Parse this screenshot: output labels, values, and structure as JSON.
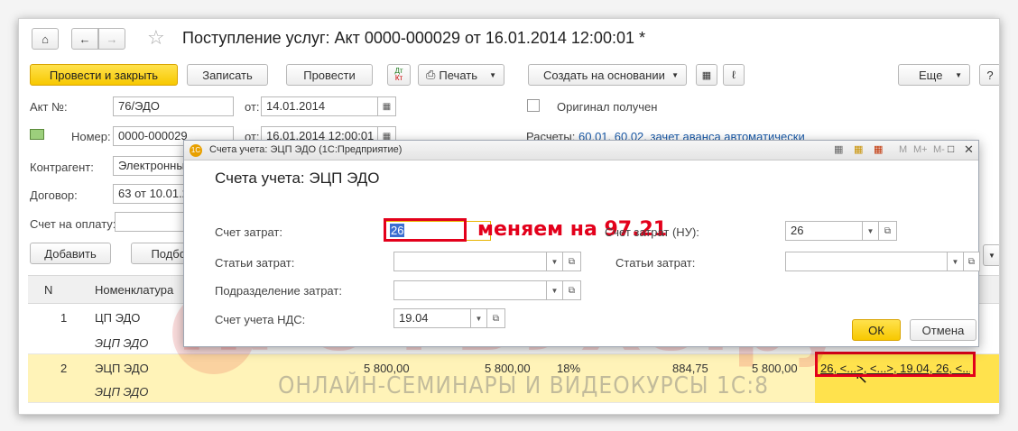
{
  "header": {
    "title": "Поступление услуг: Акт 0000-000029 от 16.01.2014 12:00:01 *"
  },
  "toolbar": {
    "post_close": "Провести и закрыть",
    "save": "Записать",
    "post": "Провести",
    "print": "Печать",
    "create_based": "Создать на основании",
    "more": "Еще",
    "help": "?"
  },
  "form": {
    "act_label": "Акт №:",
    "act_value": "76/ЭДО",
    "from_label": "от:",
    "act_date": "14.01.2014",
    "original_label": "Оригинал получен",
    "number_label": "Номер:",
    "number_value": "0000-000029",
    "number_date": "16.01.2014 12:00:01",
    "settlements_label": "Расчеты:",
    "settlements_link": "60.01, 60.02, зачет аванса автоматически",
    "contractor_label": "Контрагент:",
    "contractor_value": "Электронный",
    "contract_label": "Договор:",
    "contract_value": "63 от 10.01.2",
    "invoice_label": "Счет на оплату:",
    "invoice_value": ""
  },
  "table_toolbar": {
    "add": "Добавить",
    "pick": "Подбо"
  },
  "table": {
    "col_n": "N",
    "col_nom": "Номенклатура",
    "rows": [
      {
        "n": "1",
        "nom": "ЦП ЭДО",
        "nom2": "ЭЦП ЭДО"
      },
      {
        "n": "2",
        "nom": "ЭЦП ЭДО",
        "nom2": "ЭЦП ЭДО",
        "qty": "5 800,00",
        "price": "5 800,00",
        "vat_rate": "18%",
        "vat": "884,75",
        "total": "5 800,00",
        "accounts": "26, <...>, <...>, 19.04, 26, <..."
      }
    ]
  },
  "dialog": {
    "window_title": "Счета учета: ЭЦП ЭДО  (1С:Предприятие)",
    "heading": "Счета учета: ЭЦП ЭДО",
    "cost_account_label": "Счет затрат:",
    "cost_account_value": "26",
    "cost_items_label": "Статьи затрат:",
    "cost_items_value": "",
    "department_label": "Подразделение затрат:",
    "department_value": "",
    "vat_account_label": "Счет учета НДС:",
    "vat_account_value": "19.04",
    "cost_account_nu_label": "Счет затрат (НУ):",
    "cost_account_nu_value": "26",
    "cost_items_right_label": "Статьи затрат:",
    "cost_items_right_value": "",
    "ok": "ОК",
    "cancel": "Отмена",
    "tb_m": "M",
    "tb_mplus": "M+",
    "tb_mminus": "M-"
  },
  "annotation": {
    "text": "меняем на 97.21"
  },
  "watermark": {
    "brand": "ПРОФБУХ8.ру",
    "tagline": "ОНЛАЙН-СЕМИНАРЫ И ВИДЕОКУРСЫ 1С:8"
  },
  "colors": {
    "accent_yellow": "#f7c800",
    "link_blue": "#1a5aa8",
    "annotation_red": "#e3001b",
    "selected_row": "#fff3b8"
  }
}
